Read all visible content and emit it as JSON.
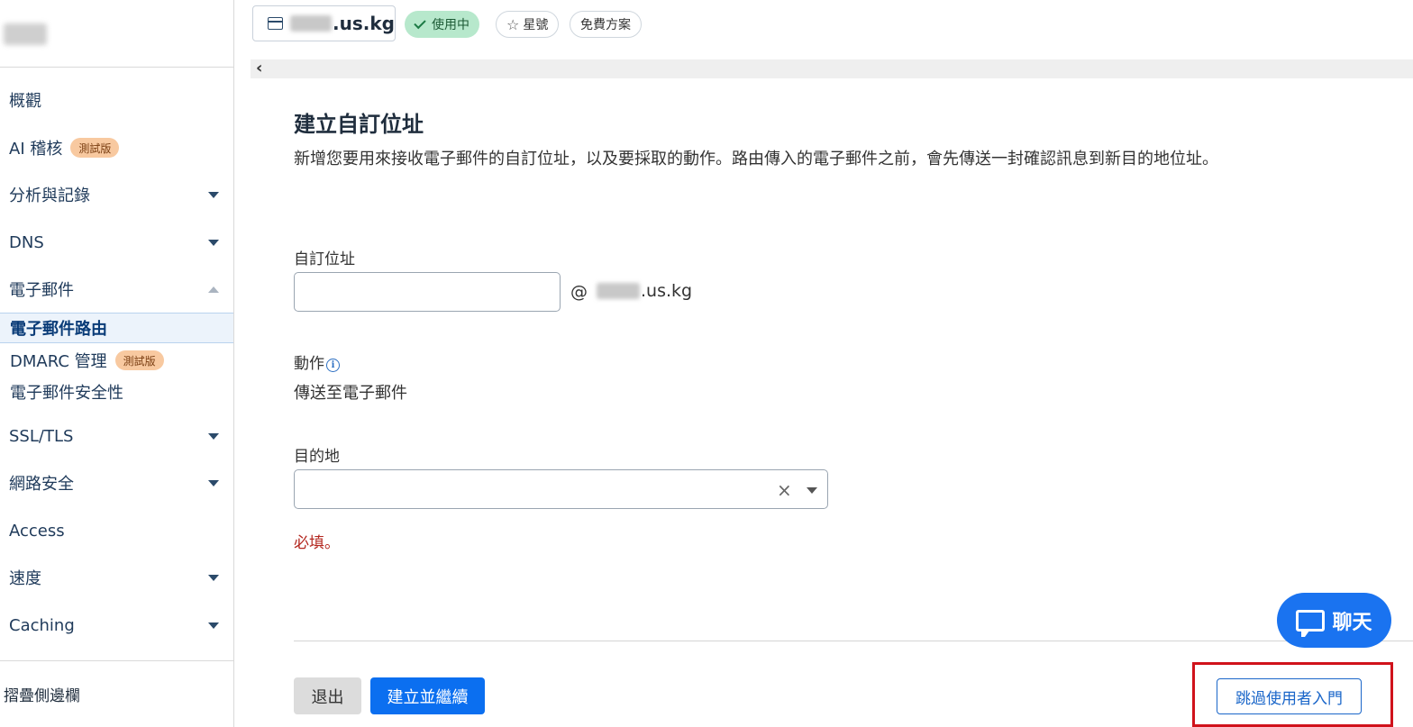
{
  "topbar": {
    "domain_suffix": ".us.kg",
    "status_active": "使用中",
    "star_label": "星號",
    "plan_label": "免費方案"
  },
  "sidebar": {
    "items": [
      {
        "label": "概觀"
      },
      {
        "label": "AI 稽核",
        "badge": "測試版"
      },
      {
        "label": "分析與記錄"
      },
      {
        "label": "DNS"
      },
      {
        "label": "電子郵件"
      },
      {
        "label": "SSL/TLS"
      },
      {
        "label": "網路安全"
      },
      {
        "label": "Access"
      },
      {
        "label": "速度"
      },
      {
        "label": "Caching"
      }
    ],
    "email_subitems": [
      {
        "label": "電子郵件路由"
      },
      {
        "label": "DMARC 管理",
        "badge": "測試版"
      },
      {
        "label": "電子郵件安全性"
      }
    ],
    "collapse_label": "摺疊側邊欄"
  },
  "main": {
    "title": "建立自訂位址",
    "description": "新增您要用來接收電子郵件的自訂位址，以及要採取的動作。路由傳入的電子郵件之前，會先傳送一封確認訊息到新目的地位址。",
    "custom_address_label": "自訂位址",
    "custom_address_value": "",
    "at_sign": "@",
    "domain_suffix": ".us.kg",
    "action_label": "動作",
    "action_value": "傳送至電子郵件",
    "destination_label": "目的地",
    "destination_value": "",
    "required_message": "必填。",
    "exit_button": "退出",
    "create_button": "建立並繼續",
    "skip_button": "跳過使用者入門"
  },
  "chat": {
    "label": "聊天"
  },
  "colors": {
    "primary": "#0b6ff0",
    "chat": "#1a73f0",
    "active_pill": "#b7e8cc",
    "badge": "#f8c9a0",
    "error": "#b3261e",
    "highlight": "#d0121b"
  }
}
